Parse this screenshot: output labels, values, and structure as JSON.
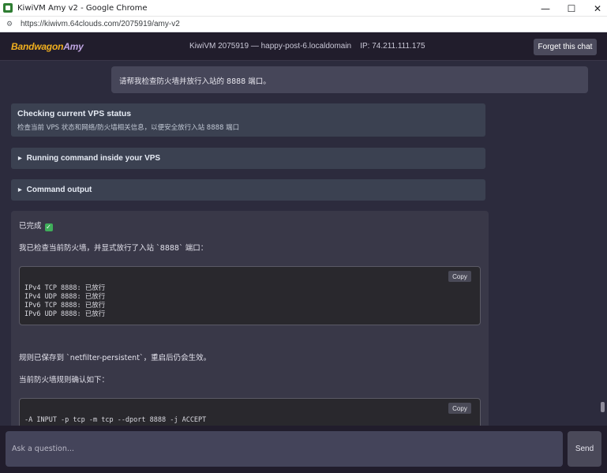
{
  "window": {
    "title": "KiwiVM Amy v2 - Google Chrome",
    "controls": [
      "—",
      "☐",
      "✕"
    ]
  },
  "browser": {
    "url": "https://kiwivm.64clouds.com/2075919/amy-v2"
  },
  "header": {
    "logo_main": "Bandwagon",
    "logo_accent": "Amy",
    "vps_info": "KiwiVM 2075919 — happy-post-6.localdomain    IP: 74.211.111.175",
    "forget_button": "Forget this chat"
  },
  "chat": {
    "user_message": "请帮我检查防火墙并放行入站的 8888 端口。",
    "status": {
      "title": "Checking current VPS status",
      "description": "检查当前 VPS 状态和网络/防火墙相关信息，以便安全放行入站 8888 端口"
    },
    "collapsibles": [
      {
        "label": "Running command inside your VPS"
      },
      {
        "label": "Command output"
      }
    ],
    "reply": {
      "done_text": "已完成",
      "intro": "我已检查当前防火墙，并显式放行了入站 `8888` 端口：",
      "code1": "IPv4 TCP 8888: 已放行\nIPv4 UDP 8888: 已放行\nIPv6 TCP 8888: 已放行\nIPv6 UDP 8888: 已放行",
      "saved": "规则已保存到 `netfilter-persistent`，重启后仍会生效。",
      "rules_intro": "当前防火墙规则确认如下：",
      "code2": "-A INPUT -p tcp -m tcp --dport 8888 -j ACCEPT",
      "copy_label": "Copy"
    }
  },
  "input": {
    "placeholder": "Ask a question...",
    "send_label": "Send"
  },
  "colors": {
    "logo_main": "#f2b01e",
    "logo_accent": "#c0a6e3",
    "background": "#2c2b3d",
    "header": "#211d2c",
    "check": "#3fae5a"
  },
  "icons": {
    "site_info": "tune-icon",
    "done": "check-mark-icon"
  }
}
